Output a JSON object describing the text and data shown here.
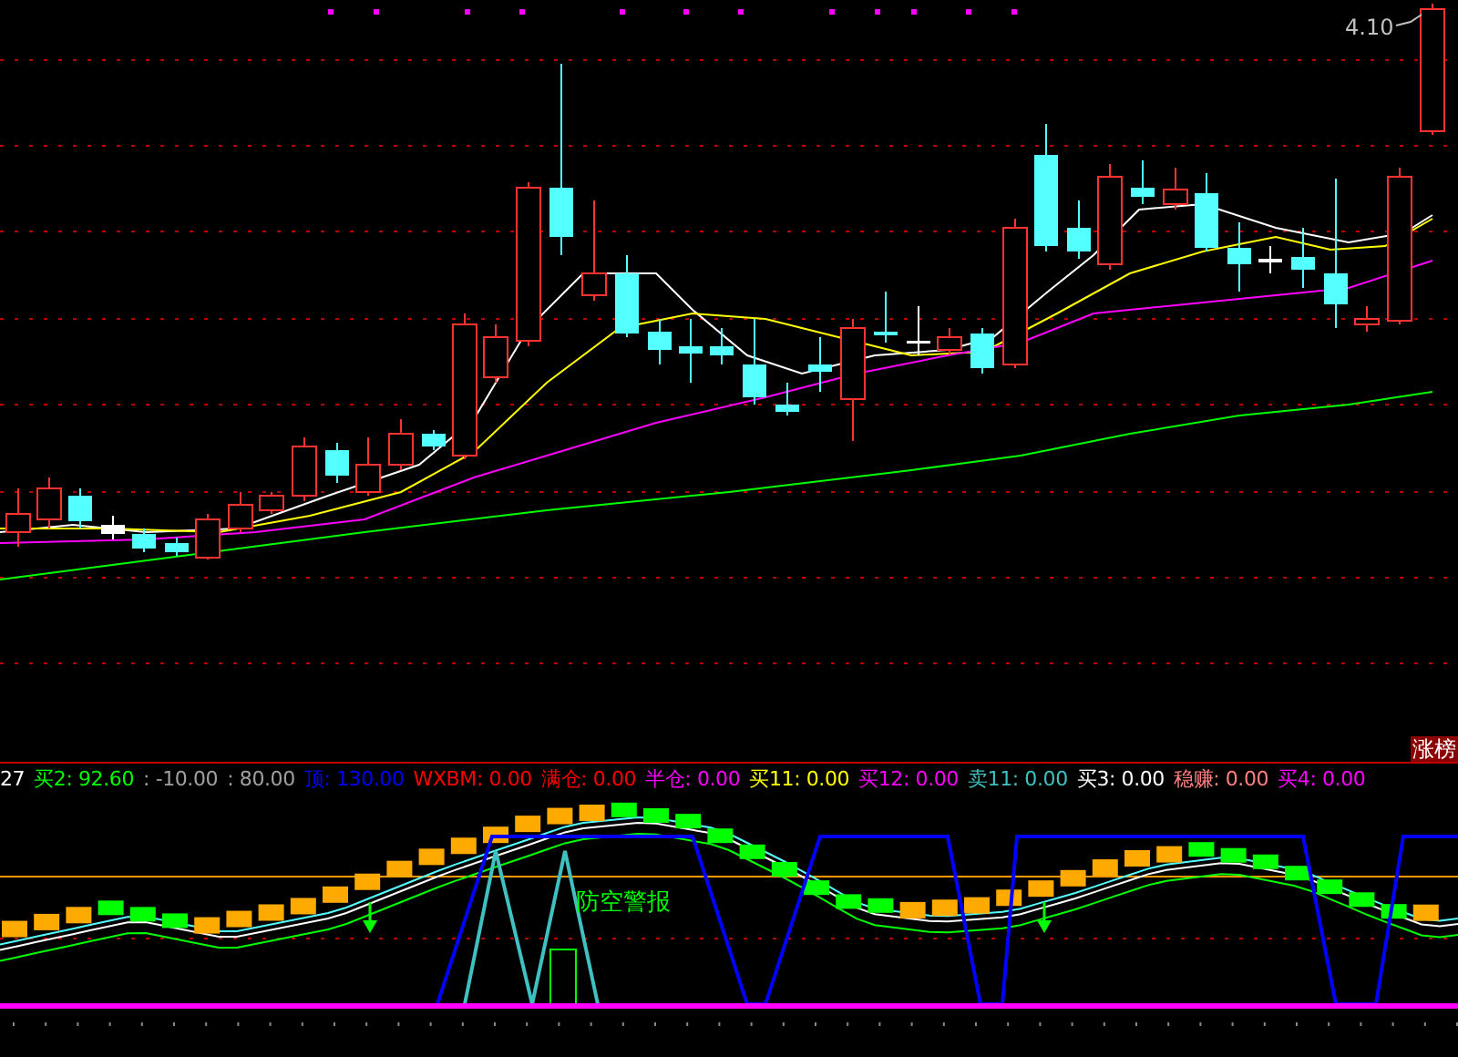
{
  "price_chart": {
    "price_label": "4.10"
  },
  "tag": {
    "label": "涨榜"
  },
  "indicator": {
    "legend": [
      {
        "text": "27",
        "color": "#ffffff"
      },
      {
        "text": "买2: 92.60",
        "color": "#00ff00"
      },
      {
        "text": ": -10.00",
        "color": "#a0a0a0"
      },
      {
        "text": ": 80.00",
        "color": "#a0a0a0"
      },
      {
        "text": "顶: 130.00",
        "color": "#0000ff"
      },
      {
        "text": "WXBM: 0.00",
        "color": "#ff0000"
      },
      {
        "text": "满仓: 0.00",
        "color": "#ff0000"
      },
      {
        "text": "半仓: 0.00",
        "color": "#ff00ff"
      },
      {
        "text": "买11: 0.00",
        "color": "#ffff00"
      },
      {
        "text": "买12: 0.00",
        "color": "#ff00ff"
      },
      {
        "text": "卖11: 0.00",
        "color": "#40c0c0"
      },
      {
        "text": "买3: 0.00",
        "color": "#ffffff"
      },
      {
        "text": "稳赚: 0.00",
        "color": "#ff8080"
      },
      {
        "text": "买4: 0.00",
        "color": "#ff00ff"
      }
    ],
    "signal_text": "防空警报"
  }
}
